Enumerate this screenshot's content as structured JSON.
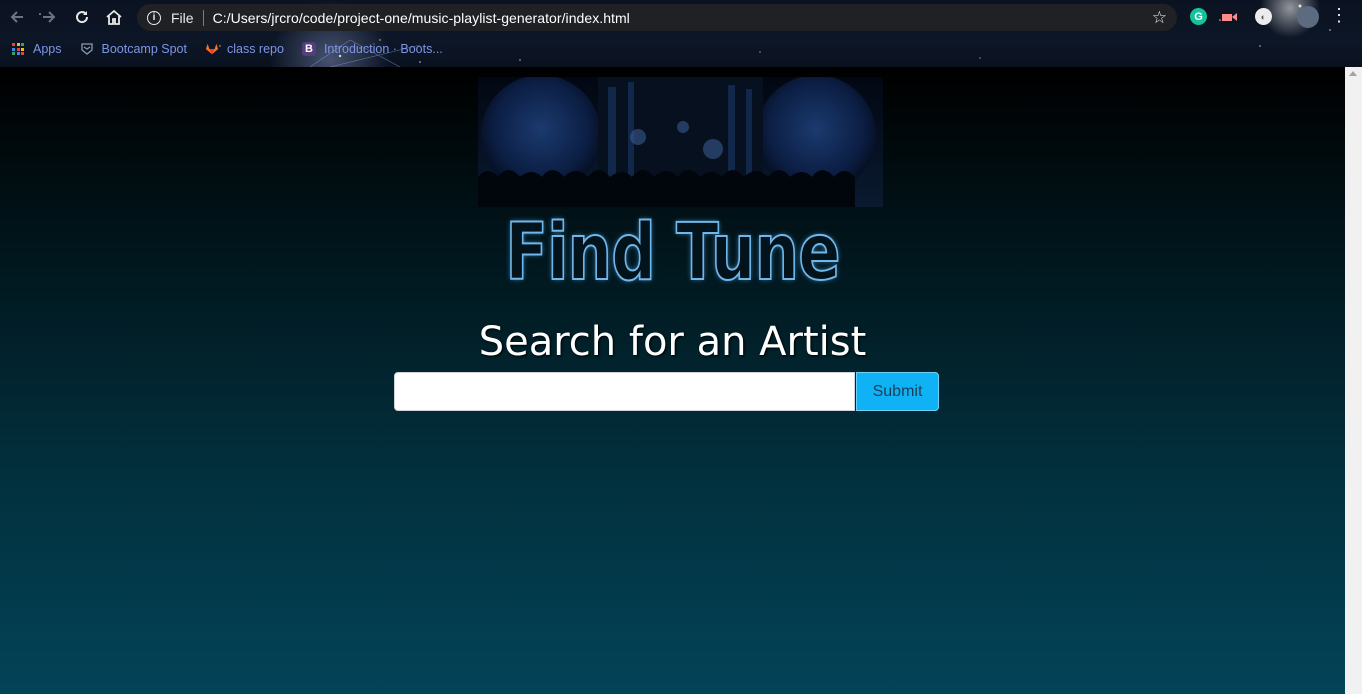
{
  "browser": {
    "omnibox": {
      "scheme_label": "File",
      "url": "C:/Users/jrcro/code/project-one/music-playlist-generator/index.html"
    },
    "bookmarks": [
      {
        "label": "Apps",
        "icon": "apps-grid-icon"
      },
      {
        "label": "Bootcamp Spot",
        "icon": "bootcamp-shield-icon"
      },
      {
        "label": "class repo",
        "icon": "gitlab-icon"
      },
      {
        "label": "Introduction · Boots...",
        "icon": "bootstrap-icon"
      }
    ]
  },
  "page": {
    "logo_text": "Find Tune",
    "search_heading": "Search for an Artist",
    "search_input_value": "",
    "submit_label": "Submit"
  },
  "colors": {
    "submit_bg": "#0fb2f5",
    "logo_outline": "#6fb6ea",
    "page_gradient_bottom": "#034358"
  }
}
